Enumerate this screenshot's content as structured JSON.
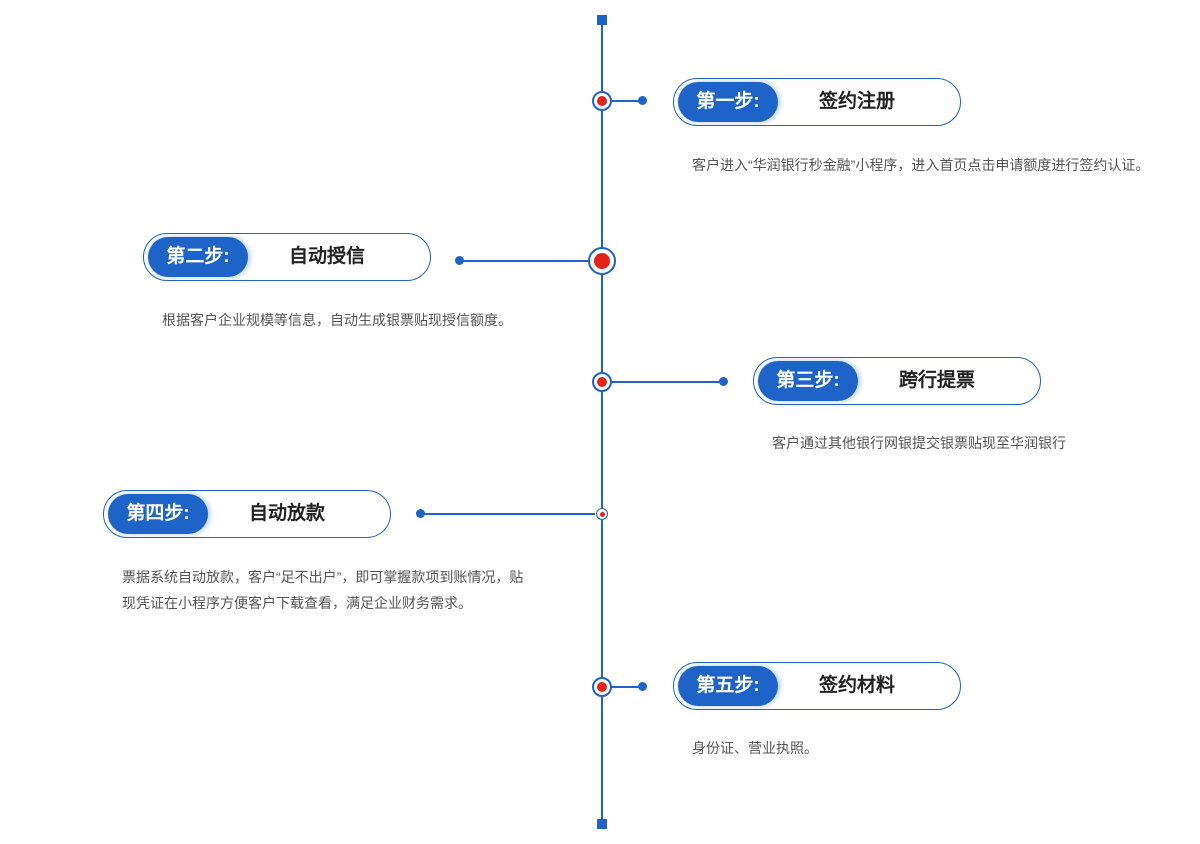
{
  "steps": [
    {
      "label": "第一步:",
      "title": "签约注册",
      "desc": [
        "客户进入“华润银行秒金融”小程序，进入首页点击申请额度进行签约认证。"
      ]
    },
    {
      "label": "第二步:",
      "title": "自动授信",
      "desc": [
        "根据客户企业规模等信息，自动生成银票贴现授信额度。"
      ]
    },
    {
      "label": "第三步:",
      "title": "跨行提票",
      "desc": [
        "客户通过其他银行网银提交银票贴现至华润银行"
      ]
    },
    {
      "label": "第四步:",
      "title": "自动放款",
      "desc": [
        "票据系统自动放款，客户“足不出户”，即可掌握款项到账情况，贴",
        "现凭证在小程序方便客户下载查看，满足企业财务需求。"
      ]
    },
    {
      "label": "第五步:",
      "title": "签约材料",
      "desc": [
        "身份证、营业执照。"
      ]
    }
  ],
  "colors": {
    "accent": "#1e63c7",
    "node_center": "#e2231a",
    "text": "#222222",
    "desc_text": "#555555"
  }
}
